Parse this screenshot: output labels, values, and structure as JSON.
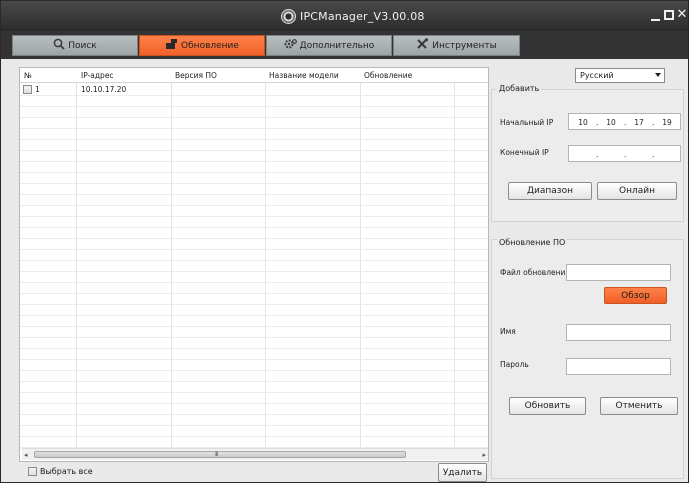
{
  "window": {
    "title": "IPCManager_V3.00.08"
  },
  "tabs": [
    {
      "label": "Поиск",
      "icon": "search-icon",
      "active": false
    },
    {
      "label": "Обновление",
      "icon": "upgrade-icon",
      "active": true
    },
    {
      "label": "Дополнительно",
      "icon": "settings-icon",
      "active": false
    },
    {
      "label": "Инструменты",
      "icon": "tools-icon",
      "active": false
    }
  ],
  "language": {
    "selected": "Русский"
  },
  "device_list": {
    "columns": [
      "№",
      "IP-адрес",
      "Версия ПО",
      "Название модели",
      "Обновление"
    ],
    "rows": [
      {
        "index": "1",
        "ip": "10.10.17.20",
        "version": "",
        "model": "",
        "status": "",
        "checked": false
      }
    ],
    "scroll_grip": "III"
  },
  "footer": {
    "select_all_label": "Выбрать все",
    "delete_label": "Удалить"
  },
  "add_group": {
    "title": "Добавить",
    "start_ip_label": "Начальный IP",
    "start_ip": [
      "10",
      "10",
      "17",
      "19"
    ],
    "end_ip_label": "Конечный IP",
    "end_ip": [
      "",
      "",
      "",
      ""
    ],
    "range_button": "Диапазон",
    "online_button": "Онлайн"
  },
  "firmware_group": {
    "title": "Обновление ПО",
    "file_label": "Файл обновления",
    "file_value": "",
    "browse_button": "Обзор",
    "name_label": "Имя",
    "name_value": "",
    "password_label": "Пароль",
    "password_value": "",
    "update_button": "Обновить",
    "cancel_button": "Отменить"
  },
  "colors": {
    "accent": "#f26a2e",
    "titlebar": "#2b2b2b",
    "tab_inactive": "#aeb4b6"
  }
}
